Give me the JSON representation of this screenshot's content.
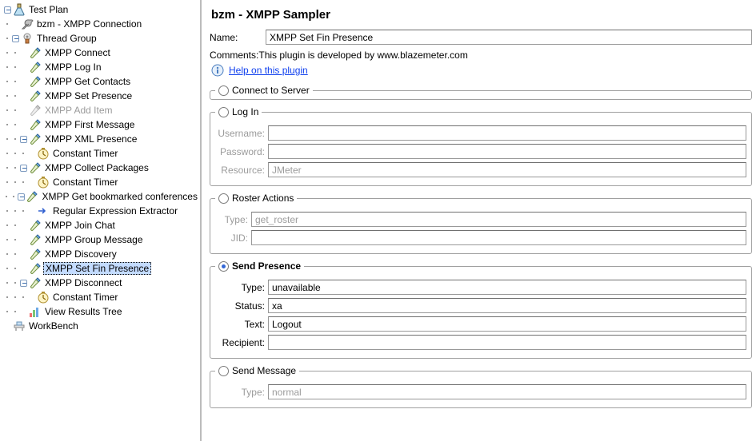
{
  "tree": {
    "test_plan": "Test Plan",
    "xmpp_connection": "bzm - XMPP Connection",
    "thread_group": "Thread Group",
    "samplers": {
      "connect": "XMPP Connect",
      "login": "XMPP Log In",
      "get_contacts": "XMPP Get Contacts",
      "set_presence": "XMPP Set Presence",
      "add_item": "XMPP Add Item",
      "first_message": "XMPP First Message",
      "xml_presence": "XMPP XML Presence",
      "timer1": "Constant Timer",
      "collect_packages": "XMPP Collect Packages",
      "timer2": "Constant Timer",
      "get_bookmarked": "XMPP Get bookmarked conferences",
      "regex": "Regular Expression Extractor",
      "join_chat": "XMPP Join Chat",
      "group_message": "XMPP Group Message",
      "discovery": "XMPP Discovery",
      "set_fin_presence": "XMPP Set Fin Presence",
      "disconnect": "XMPP Disconnect",
      "timer3": "Constant Timer",
      "view_results": "View Results Tree"
    },
    "workbench": "WorkBench"
  },
  "panel": {
    "title": "bzm - XMPP Sampler",
    "name_label": "Name:",
    "name_value": "XMPP Set Fin Presence",
    "comments_label": "Comments:",
    "comments_value": "This plugin is developed by www.blazemeter.com",
    "help_link": "Help on this plugin",
    "groups": {
      "connect": "Connect to Server",
      "login": "Log In",
      "roster": "Roster Actions",
      "presence": "Send Presence",
      "message": "Send Message"
    },
    "login": {
      "username_label": "Username:",
      "username": "",
      "password_label": "Password:",
      "password": "",
      "resource_label": "Resource:",
      "resource_placeholder": "JMeter"
    },
    "roster": {
      "type_label": "Type:",
      "type_placeholder": "get_roster",
      "jid_label": "JID:",
      "jid": ""
    },
    "presence": {
      "type_label": "Type:",
      "type": "unavailable",
      "status_label": "Status:",
      "status": "xa",
      "text_label": "Text:",
      "text": "Logout",
      "recipient_label": "Recipient:",
      "recipient": ""
    },
    "message": {
      "type_label": "Type:",
      "type_placeholder": "normal"
    }
  }
}
